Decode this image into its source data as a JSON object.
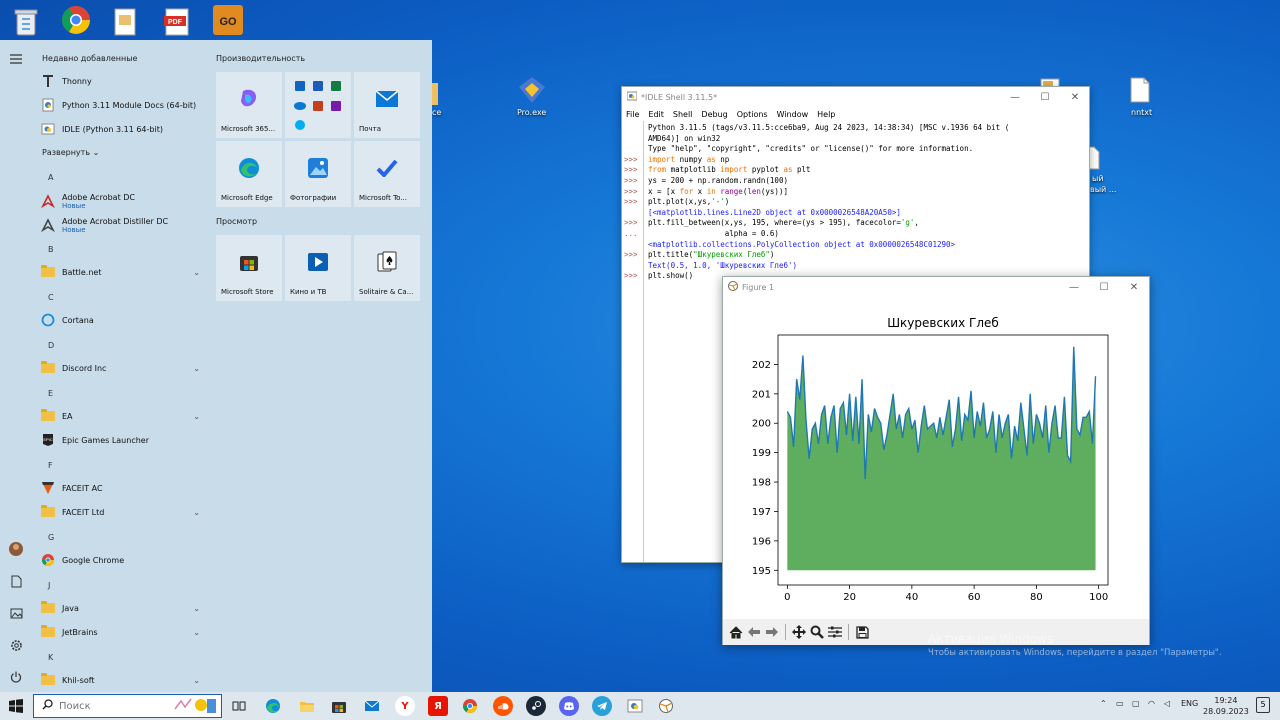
{
  "desktop": {
    "icons": [
      {
        "name": "recycle-bin-icon",
        "label": ""
      },
      {
        "name": "chrome-icon",
        "label": ""
      },
      {
        "name": "file-icon",
        "label": ""
      },
      {
        "name": "pdf-icon",
        "label": ""
      },
      {
        "name": "csgo-icon",
        "label": ""
      },
      {
        "name": "pro-exe-icon",
        "label": "Pro.exe"
      },
      {
        "name": "nnbxt-icon",
        "label": "nntxt"
      }
    ],
    "partial_labels": [
      "ce",
      "ый",
      "вый ..."
    ]
  },
  "start_menu": {
    "recent_header": "Недавно добавленные",
    "recent": [
      "Thonny",
      "Python 3.11 Module Docs (64-bit)",
      "IDLE (Python 3.11 64-bit)"
    ],
    "expand_label": "Развернуть",
    "apps": [
      {
        "type": "letter",
        "text": "A"
      },
      {
        "type": "app",
        "label": "Adobe Acrobat DC",
        "sub": "Новые",
        "icon": "acrobat-icon"
      },
      {
        "type": "app",
        "label": "Adobe Acrobat Distiller DC",
        "sub": "Новые",
        "icon": "acrobat-distiller-icon"
      },
      {
        "type": "letter",
        "text": "B"
      },
      {
        "type": "folder",
        "label": "Battle.net"
      },
      {
        "type": "letter",
        "text": "C"
      },
      {
        "type": "app",
        "label": "Cortana",
        "icon": "cortana-icon"
      },
      {
        "type": "letter",
        "text": "D"
      },
      {
        "type": "folder",
        "label": "Discord Inc"
      },
      {
        "type": "letter",
        "text": "E"
      },
      {
        "type": "folder",
        "label": "EA"
      },
      {
        "type": "app",
        "label": "Epic Games Launcher",
        "icon": "epic-icon"
      },
      {
        "type": "letter",
        "text": "F"
      },
      {
        "type": "app",
        "label": "FACEIT AC",
        "icon": "faceit-icon"
      },
      {
        "type": "folder",
        "label": "FACEIT Ltd"
      },
      {
        "type": "letter",
        "text": "G"
      },
      {
        "type": "app",
        "label": "Google Chrome",
        "icon": "chrome-icon"
      },
      {
        "type": "letter",
        "text": "J"
      },
      {
        "type": "folder",
        "label": "Java"
      },
      {
        "type": "folder",
        "label": "JetBrains"
      },
      {
        "type": "letter",
        "text": "K"
      },
      {
        "type": "folder",
        "label": "Khil-soft"
      }
    ],
    "groups": [
      {
        "title": "Производительность"
      },
      {
        "title": "Просмотр"
      }
    ],
    "tiles": [
      {
        "label": "Microsoft 365...",
        "icon": "m365-icon"
      },
      {
        "label": "",
        "icon": "office-apps-icon"
      },
      {
        "label": "Почта",
        "icon": "mail-icon"
      },
      {
        "label": "Microsoft Edge",
        "icon": "edge-icon"
      },
      {
        "label": "Фотографии",
        "icon": "photos-icon"
      },
      {
        "label": "Microsoft To...",
        "icon": "todo-icon"
      },
      {
        "label": "Microsoft Store",
        "icon": "store-icon"
      },
      {
        "label": "Кино и ТВ",
        "icon": "movies-icon"
      },
      {
        "label": "Solitaire & Ca...",
        "icon": "solitaire-icon"
      }
    ]
  },
  "idle": {
    "title": "*IDLE Shell 3.11.5*",
    "menu": [
      "File",
      "Edit",
      "Shell",
      "Debug",
      "Options",
      "Window",
      "Help"
    ],
    "lines": [
      {
        "p": "",
        "t": "Python 3.11.5 (tags/v3.11.5:cce6ba9, Aug 24 2023, 14:38:34) [MSC v.1936 64 bit (",
        "c": ""
      },
      {
        "p": "",
        "t": "AMD64)] on win32",
        "c": ""
      },
      {
        "p": "",
        "t": "Type \"help\", \"copyright\", \"credits\" or \"license()\" for more information.",
        "c": ""
      },
      {
        "p": ">>>",
        "t": "import numpy as np",
        "c": "code"
      },
      {
        "p": ">>>",
        "t": "from matplotlib import pyplot as plt",
        "c": "code"
      },
      {
        "p": ">>>",
        "t": "ys = 200 + np.random.randn(100)",
        "c": "code"
      },
      {
        "p": ">>>",
        "t": "x = [x for x in range(len(ys))]",
        "c": "code"
      },
      {
        "p": ">>>",
        "t": "plt.plot(x,ys,'-')",
        "c": "code"
      },
      {
        "p": "",
        "t": "[<matplotlib.lines.Line2D object at 0x0000026548A20A50>]",
        "c": "out"
      },
      {
        "p": ">>>",
        "t": "plt.fill_between(x,ys, 195, where=(ys > 195), facecolor='g',",
        "c": "code"
      },
      {
        "p": "...",
        "t": "                 alpha = 0.6)",
        "c": "code"
      },
      {
        "p": "",
        "t": "<matplotlib.collections.PolyCollection object at 0x0000026548C01290>",
        "c": "out"
      },
      {
        "p": ">>>",
        "t": "plt.title(\"Шкуревских Глеб\")",
        "c": "code"
      },
      {
        "p": "",
        "t": "Text(0.5, 1.0, 'Шкуревских Глеб')",
        "c": "out"
      },
      {
        "p": ">>>",
        "t": "plt.show()",
        "c": "code"
      }
    ]
  },
  "figure": {
    "title": "Figure 1",
    "toolbar": [
      "home-icon",
      "back-icon",
      "forward-icon",
      "pan-icon",
      "zoom-icon",
      "configure-icon",
      "save-icon"
    ]
  },
  "chart_data": {
    "type": "area",
    "title": "Шкуревских Глеб",
    "xlabel": "",
    "ylabel": "",
    "xlim": [
      -3,
      103
    ],
    "ylim": [
      194.5,
      203.0
    ],
    "xticks": [
      0,
      20,
      40,
      60,
      80,
      100
    ],
    "yticks": [
      195,
      196,
      197,
      198,
      199,
      200,
      201,
      202
    ],
    "fill_baseline": 195,
    "fill_color": "#5fae5f",
    "line_color": "#1f77b4",
    "series": [
      {
        "x": [
          0,
          1,
          2,
          3,
          4,
          5,
          6,
          7,
          8,
          9,
          10,
          11,
          12,
          13,
          14,
          15,
          16,
          17,
          18,
          19,
          20,
          21,
          22,
          23,
          24,
          25,
          26,
          27,
          28,
          29,
          30,
          31,
          32,
          33,
          34,
          35,
          36,
          37,
          38,
          39,
          40,
          41,
          42,
          43,
          44,
          45,
          46,
          47,
          48,
          49,
          50,
          51,
          52,
          53,
          54,
          55,
          56,
          57,
          58,
          59,
          60,
          61,
          62,
          63,
          64,
          65,
          66,
          67,
          68,
          69,
          70,
          71,
          72,
          73,
          74,
          75,
          76,
          77,
          78,
          79,
          80,
          81,
          82,
          83,
          84,
          85,
          86,
          87,
          88,
          89,
          90,
          91,
          92,
          93,
          94,
          95,
          96,
          97,
          98,
          99
        ],
        "values": [
          200.4,
          200.2,
          199.2,
          201.5,
          200.8,
          202.3,
          200.1,
          198.8,
          199.8,
          200.0,
          199.3,
          200.3,
          200.6,
          199.3,
          200.2,
          200.6,
          199.0,
          200.5,
          200.7,
          199.6,
          201.0,
          199.4,
          200.9,
          199.3,
          201.5,
          198.1,
          200.3,
          199.7,
          200.5,
          200.2,
          200.0,
          199.1,
          199.6,
          200.3,
          201.0,
          199.8,
          200.3,
          199.5,
          200.3,
          200.5,
          199.8,
          200.1,
          199.0,
          199.9,
          200.6,
          199.8,
          199.9,
          200.0,
          199.5,
          200.2,
          199.6,
          200.2,
          200.8,
          199.2,
          199.8,
          200.9,
          199.4,
          200.3,
          200.1,
          201.1,
          199.5,
          200.4,
          199.9,
          200.7,
          199.5,
          199.8,
          200.4,
          199.0,
          200.3,
          199.5,
          200.0,
          200.3,
          198.8,
          199.9,
          199.4,
          200.7,
          199.8,
          198.9,
          201.0,
          199.3,
          200.3,
          200.0,
          199.5,
          200.6,
          199.0,
          200.0,
          200.6,
          199.5,
          199.5,
          200.9,
          198.9,
          198.7,
          202.6,
          199.8,
          199.6,
          200.2,
          200.2,
          200.4,
          199.3,
          201.6
        ]
      }
    ]
  },
  "taskbar": {
    "search_placeholder": "Поиск",
    "apps": [
      "task-view-icon",
      "edge-icon",
      "explorer-icon",
      "store-icon",
      "mail-icon",
      "yandex-browser-icon",
      "yandex-icon",
      "chrome-icon",
      "soundcloud-icon",
      "steam-icon",
      "discord-icon",
      "telegram-icon",
      "python-icon",
      "idle-icon"
    ],
    "lang": "ENG",
    "time": "19:24",
    "date": "28.09.2023",
    "notif_count": "5"
  },
  "watermark": {
    "line1": "Активация Windows",
    "line2": "Чтобы активировать Windows, перейдите в раздел \"Параметры\"."
  }
}
